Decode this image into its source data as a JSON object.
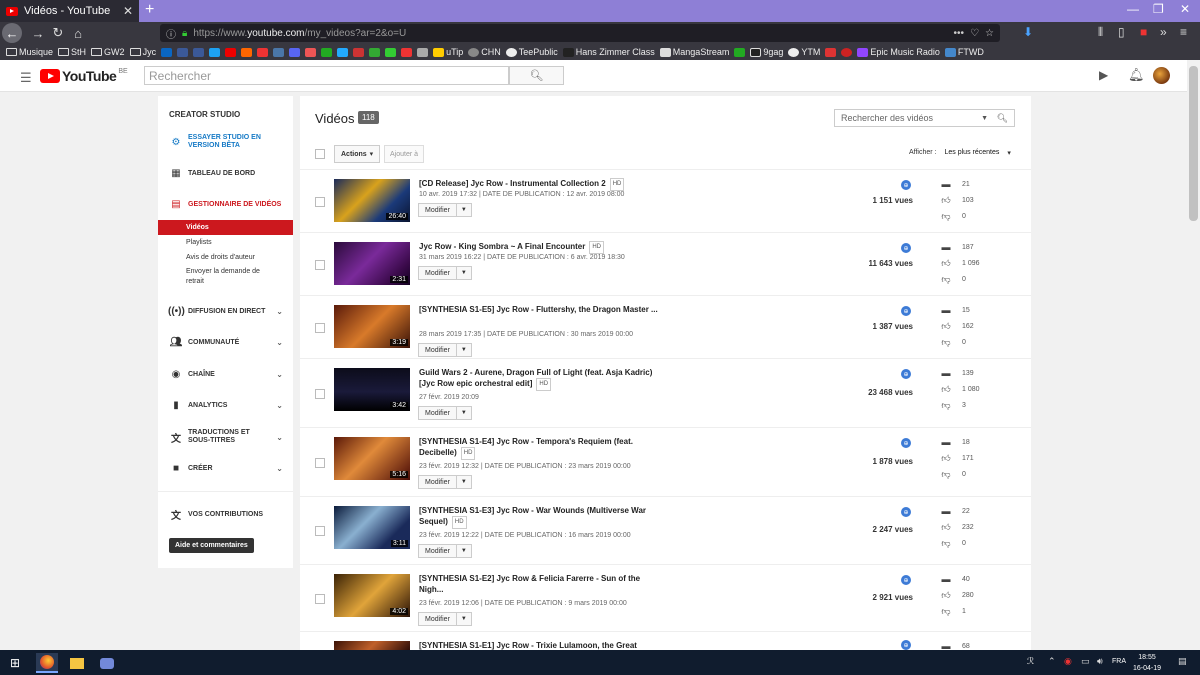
{
  "browser": {
    "tab_title": "Vidéos - YouTube",
    "url_prefix": "https://www.",
    "url_domain": "youtube.com",
    "url_path": "/my_videos?ar=2&o=U",
    "bookmarks": [
      "Musique",
      "StH",
      "GW2",
      "Jyc",
      "uTip",
      "CHN",
      "TeePublic",
      "Hans Zimmer Class",
      "MangaStream",
      "9gag",
      "YTM",
      "Epic Music Radio",
      "FTWD"
    ]
  },
  "yt": {
    "logo": "YouTube",
    "region": "BE",
    "search_placeholder": "Rechercher"
  },
  "sidebar": {
    "header": "CREATOR STUDIO",
    "beta": "ESSAYER STUDIO EN VERSION BÊTA",
    "dashboard": "TABLEAU DE BORD",
    "video_manager": "GESTIONNAIRE DE VIDÉOS",
    "sub": [
      "Vidéos",
      "Playlists",
      "Avis de droits d'auteur",
      "Envoyer la demande de retrait"
    ],
    "live": "DIFFUSION EN DIRECT",
    "community": "COMMUNAUTÉ",
    "channel": "CHAÎNE",
    "analytics": "ANALYTICS",
    "translations": "TRADUCTIONS ET SOUS-TITRES",
    "create": "CRÉER",
    "contributions": "VOS CONTRIBUTIONS",
    "help": "Aide et commentaires"
  },
  "main": {
    "title": "Vidéos",
    "count": "118",
    "search_placeholder": "Rechercher des vidéos",
    "actions": "Actions",
    "add_to": "Ajouter à",
    "show_label": "Afficher :",
    "show_value": "Les plus récentes",
    "edit_label": "Modifier",
    "videos": [
      {
        "title": "[CD Release] Jyc Row - Instrumental Collection 2",
        "hd": "HD",
        "date": "10 avr. 2019 17:32 | DATE DE PUBLICATION : 12 avr. 2019 08:00",
        "duration": "26:40",
        "views": "1 151 vues",
        "comments": "21",
        "likes": "103",
        "dislikes": "0"
      },
      {
        "title": "Jyc Row - King Sombra ~ A Final Encounter",
        "hd": "HD",
        "date": "31 mars 2019 16:22 | DATE DE PUBLICATION : 6 avr. 2019 18:30",
        "duration": "2:31",
        "views": "11 643 vues",
        "comments": "187",
        "likes": "1 096",
        "dislikes": "0"
      },
      {
        "title": "[SYNTHESIA S1-E5] Jyc Row - Fluttershy, the Dragon Master ...",
        "hd": "",
        "date": "28 mars 2019 17:35 | DATE DE PUBLICATION : 30 mars 2019 00:00",
        "duration": "3:19",
        "views": "1 387 vues",
        "comments": "15",
        "likes": "162",
        "dislikes": "0"
      },
      {
        "title": "Guild Wars 2 - Aurene, Dragon Full of Light (feat. Asja Kadric) [Jyc Row epic orchestral edit]",
        "hd": "HD",
        "date": "27 févr. 2019 20:09",
        "duration": "3:42",
        "views": "23 468 vues",
        "comments": "139",
        "likes": "1 080",
        "dislikes": "3"
      },
      {
        "title": "[SYNTHESIA S1-E4] Jyc Row - Tempora's Requiem (feat. Decibelle)",
        "hd": "HD",
        "date": "23 févr. 2019 12:32 | DATE DE PUBLICATION : 23 mars 2019 00:00",
        "duration": "5:16",
        "views": "1 878 vues",
        "comments": "18",
        "likes": "171",
        "dislikes": "0"
      },
      {
        "title": "[SYNTHESIA S1-E3] Jyc Row - War Wounds (Multiverse War Sequel)",
        "hd": "HD",
        "date": "23 févr. 2019 12:22 | DATE DE PUBLICATION : 16 mars 2019 00:00",
        "duration": "3:11",
        "views": "2 247 vues",
        "comments": "22",
        "likes": "232",
        "dislikes": "0"
      },
      {
        "title": "[SYNTHESIA S1-E2] Jyc Row & Felicia Farerre - Sun of the Nigh...",
        "hd": "",
        "date": "23 févr. 2019 12:06 | DATE DE PUBLICATION : 9 mars 2019 00:00",
        "duration": "4:02",
        "views": "2 921 vues",
        "comments": "40",
        "likes": "280",
        "dislikes": "1"
      },
      {
        "title": "[SYNTHESIA S1-E1] Jyc Row - Trixie Lulamoon, the Great",
        "hd": "",
        "date": "",
        "duration": "",
        "views": "",
        "comments": "68",
        "likes": "",
        "dislikes": ""
      }
    ]
  },
  "taskbar": {
    "lang": "FRA",
    "time": "18:55",
    "date": "16-04-19"
  }
}
